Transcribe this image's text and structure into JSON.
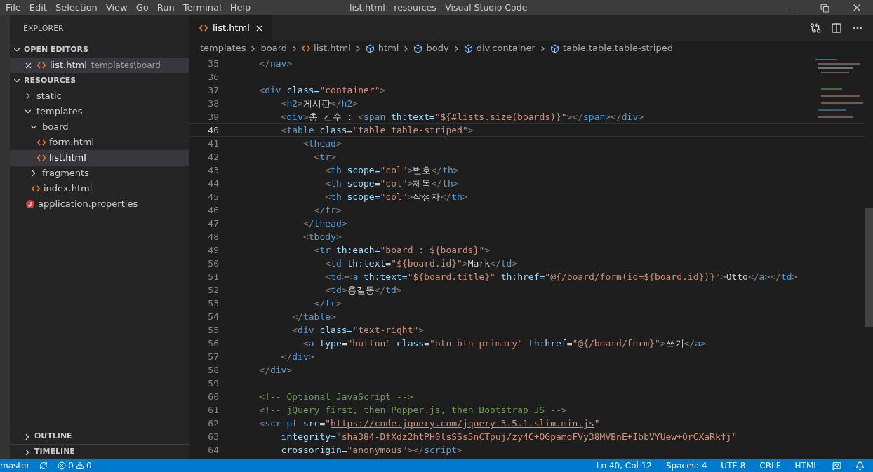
{
  "window": {
    "title": "list.html - resources - Visual Studio Code"
  },
  "menu": [
    "File",
    "Edit",
    "Selection",
    "View",
    "Go",
    "Run",
    "Terminal",
    "Help"
  ],
  "sidebar": {
    "title": "EXPLORER",
    "open_editors": {
      "label": "OPEN EDITORS",
      "expanded": true,
      "items": [
        {
          "name": "list.html",
          "path": "templates\\board",
          "selected": true
        }
      ]
    },
    "folder": {
      "label": "RESOURCES",
      "expanded": true,
      "children": [
        {
          "kind": "folder",
          "name": "static",
          "expanded": false,
          "selected": false
        },
        {
          "kind": "folder",
          "name": "templates",
          "expanded": true,
          "selected": false,
          "children": [
            {
              "kind": "folder",
              "name": "board",
              "expanded": true,
              "selected": false,
              "children": [
                {
                  "kind": "html",
                  "name": "form.html",
                  "selected": false
                },
                {
                  "kind": "html",
                  "name": "list.html",
                  "selected": true
                }
              ]
            },
            {
              "kind": "folder",
              "name": "fragments",
              "expanded": false,
              "selected": false
            },
            {
              "kind": "html",
              "name": "index.html",
              "selected": false
            }
          ]
        },
        {
          "kind": "properties",
          "name": "application.properties",
          "selected": false
        }
      ]
    },
    "sections": [
      {
        "label": "OUTLINE",
        "expanded": false
      },
      {
        "label": "TIMELINE",
        "expanded": false
      }
    ]
  },
  "tabs": [
    {
      "label": "list.html",
      "selected": true
    }
  ],
  "breadcrumb": [
    {
      "kind": "folder",
      "label": "templates"
    },
    {
      "kind": "folder",
      "label": "board"
    },
    {
      "kind": "html",
      "label": "list.html"
    },
    {
      "kind": "element",
      "label": "html"
    },
    {
      "kind": "element",
      "label": "body"
    },
    {
      "kind": "element",
      "label": "div.container"
    },
    {
      "kind": "element",
      "label": "table.table.table-striped"
    }
  ],
  "code": [
    {
      "number": "35",
      "current": false,
      "tokens": [
        {
          "kind": "punct",
          "text": "    </"
        },
        {
          "kind": "tag",
          "text": "nav"
        },
        {
          "kind": "punct",
          "text": ">"
        }
      ]
    },
    {
      "number": "36",
      "current": false
    },
    {
      "number": "37",
      "current": false,
      "tokens": [
        {
          "kind": "punct",
          "text": "    <"
        },
        {
          "kind": "tag",
          "text": "div"
        },
        {
          "kind": "attr",
          "text": " class="
        },
        {
          "kind": "string",
          "text": "\"container\""
        },
        {
          "kind": "punct",
          "text": ">"
        }
      ]
    },
    {
      "number": "38",
      "current": false,
      "tokens": [
        {
          "kind": "punct",
          "text": "        <"
        },
        {
          "kind": "tag",
          "text": "h2"
        },
        {
          "kind": "punct",
          "text": ">"
        },
        {
          "kind": "text",
          "text": "게시판"
        },
        {
          "kind": "punct",
          "text": "</"
        },
        {
          "kind": "tag",
          "text": "h2"
        },
        {
          "kind": "punct",
          "text": ">"
        }
      ]
    },
    {
      "number": "39",
      "current": false,
      "tokens": [
        {
          "kind": "punct",
          "text": "        <"
        },
        {
          "kind": "tag",
          "text": "div"
        },
        {
          "kind": "punct",
          "text": ">"
        },
        {
          "kind": "text",
          "text": "총 건수 : "
        },
        {
          "kind": "punct",
          "text": "<"
        },
        {
          "kind": "tag",
          "text": "span"
        },
        {
          "kind": "attr",
          "text": " th:text="
        },
        {
          "kind": "string",
          "text": "\"${#lists.size(boards)}\""
        },
        {
          "kind": "punct",
          "text": "></"
        },
        {
          "kind": "tag",
          "text": "span"
        },
        {
          "kind": "punct",
          "text": "></"
        },
        {
          "kind": "tag",
          "text": "div"
        },
        {
          "kind": "punct",
          "text": ">"
        }
      ]
    },
    {
      "number": "40",
      "current": true,
      "tokens": [
        {
          "kind": "punct",
          "text": "        <"
        },
        {
          "kind": "tag",
          "text": "table"
        },
        {
          "kind": "attr",
          "text": " class="
        },
        {
          "kind": "string",
          "text": "\"table table-striped\""
        },
        {
          "kind": "punct",
          "text": ">"
        }
      ]
    },
    {
      "number": "41",
      "current": false,
      "tokens": [
        {
          "kind": "punct",
          "text": "            <"
        },
        {
          "kind": "tag",
          "text": "thead"
        },
        {
          "kind": "punct",
          "text": ">"
        }
      ]
    },
    {
      "number": "42",
      "current": false,
      "tokens": [
        {
          "kind": "punct",
          "text": "              <"
        },
        {
          "kind": "tag",
          "text": "tr"
        },
        {
          "kind": "punct",
          "text": ">"
        }
      ]
    },
    {
      "number": "43",
      "current": false,
      "tokens": [
        {
          "kind": "punct",
          "text": "                <"
        },
        {
          "kind": "tag",
          "text": "th"
        },
        {
          "kind": "attr",
          "text": " scope="
        },
        {
          "kind": "string",
          "text": "\"col\""
        },
        {
          "kind": "punct",
          "text": ">"
        },
        {
          "kind": "text",
          "text": "번호"
        },
        {
          "kind": "punct",
          "text": "</"
        },
        {
          "kind": "tag",
          "text": "th"
        },
        {
          "kind": "punct",
          "text": ">"
        }
      ]
    },
    {
      "number": "44",
      "current": false,
      "tokens": [
        {
          "kind": "punct",
          "text": "                <"
        },
        {
          "kind": "tag",
          "text": "th"
        },
        {
          "kind": "attr",
          "text": " scope="
        },
        {
          "kind": "string",
          "text": "\"col\""
        },
        {
          "kind": "punct",
          "text": ">"
        },
        {
          "kind": "text",
          "text": "제목"
        },
        {
          "kind": "punct",
          "text": "</"
        },
        {
          "kind": "tag",
          "text": "th"
        },
        {
          "kind": "punct",
          "text": ">"
        }
      ]
    },
    {
      "number": "45",
      "current": false,
      "tokens": [
        {
          "kind": "punct",
          "text": "                <"
        },
        {
          "kind": "tag",
          "text": "th"
        },
        {
          "kind": "attr",
          "text": " scope="
        },
        {
          "kind": "string",
          "text": "\"col\""
        },
        {
          "kind": "punct",
          "text": ">"
        },
        {
          "kind": "text",
          "text": "작성자"
        },
        {
          "kind": "punct",
          "text": "</"
        },
        {
          "kind": "tag",
          "text": "th"
        },
        {
          "kind": "punct",
          "text": ">"
        }
      ]
    },
    {
      "number": "46",
      "current": false,
      "tokens": [
        {
          "kind": "punct",
          "text": "              </"
        },
        {
          "kind": "tag",
          "text": "tr"
        },
        {
          "kind": "punct",
          "text": ">"
        }
      ]
    },
    {
      "number": "47",
      "current": false,
      "tokens": [
        {
          "kind": "punct",
          "text": "            </"
        },
        {
          "kind": "tag",
          "text": "thead"
        },
        {
          "kind": "punct",
          "text": ">"
        }
      ]
    },
    {
      "number": "48",
      "current": false,
      "tokens": [
        {
          "kind": "punct",
          "text": "            <"
        },
        {
          "kind": "tag",
          "text": "tbody"
        },
        {
          "kind": "punct",
          "text": ">"
        }
      ]
    },
    {
      "number": "49",
      "current": false,
      "tokens": [
        {
          "kind": "punct",
          "text": "              <"
        },
        {
          "kind": "tag",
          "text": "tr"
        },
        {
          "kind": "attr",
          "text": " th:each="
        },
        {
          "kind": "string",
          "text": "\"board : ${boards}\""
        },
        {
          "kind": "punct",
          "text": ">"
        }
      ]
    },
    {
      "number": "50",
      "current": false,
      "tokens": [
        {
          "kind": "punct",
          "text": "                <"
        },
        {
          "kind": "tag",
          "text": "td"
        },
        {
          "kind": "attr",
          "text": " th:text="
        },
        {
          "kind": "string",
          "text": "\"${board.id}\""
        },
        {
          "kind": "punct",
          "text": ">"
        },
        {
          "kind": "text",
          "text": "Mark"
        },
        {
          "kind": "punct",
          "text": "</"
        },
        {
          "kind": "tag",
          "text": "td"
        },
        {
          "kind": "punct",
          "text": ">"
        }
      ]
    },
    {
      "number": "51",
      "current": false,
      "tokens": [
        {
          "kind": "punct",
          "text": "                <"
        },
        {
          "kind": "tag",
          "text": "td"
        },
        {
          "kind": "punct",
          "text": "><"
        },
        {
          "kind": "tag",
          "text": "a"
        },
        {
          "kind": "attr",
          "text": " th:text="
        },
        {
          "kind": "string",
          "text": "\"${board.title}\""
        },
        {
          "kind": "attr",
          "text": " th:href="
        },
        {
          "kind": "string",
          "text": "\"@{/board/form(id=${board.id})}\""
        },
        {
          "kind": "punct",
          "text": ">"
        },
        {
          "kind": "text",
          "text": "Otto"
        },
        {
          "kind": "punct",
          "text": "</"
        },
        {
          "kind": "tag",
          "text": "a"
        },
        {
          "kind": "punct",
          "text": "></"
        },
        {
          "kind": "tag",
          "text": "td"
        },
        {
          "kind": "punct",
          "text": ">"
        }
      ]
    },
    {
      "number": "52",
      "current": false,
      "tokens": [
        {
          "kind": "punct",
          "text": "                <"
        },
        {
          "kind": "tag",
          "text": "td"
        },
        {
          "kind": "punct",
          "text": ">"
        },
        {
          "kind": "text",
          "text": "홍길동"
        },
        {
          "kind": "punct",
          "text": "</"
        },
        {
          "kind": "tag",
          "text": "td"
        },
        {
          "kind": "punct",
          "text": ">"
        }
      ]
    },
    {
      "number": "53",
      "current": false,
      "tokens": [
        {
          "kind": "punct",
          "text": "              </"
        },
        {
          "kind": "tag",
          "text": "tr"
        },
        {
          "kind": "punct",
          "text": ">"
        }
      ]
    },
    {
      "number": "54",
      "current": false,
      "tokens": [
        {
          "kind": "punct",
          "text": "          </"
        },
        {
          "kind": "tag",
          "text": "table"
        },
        {
          "kind": "punct",
          "text": ">"
        }
      ]
    },
    {
      "number": "55",
      "current": false,
      "tokens": [
        {
          "kind": "punct",
          "text": "          <"
        },
        {
          "kind": "tag",
          "text": "div"
        },
        {
          "kind": "attr",
          "text": " class="
        },
        {
          "kind": "string",
          "text": "\"text-right\""
        },
        {
          "kind": "punct",
          "text": ">"
        }
      ]
    },
    {
      "number": "56",
      "current": false,
      "tokens": [
        {
          "kind": "punct",
          "text": "            <"
        },
        {
          "kind": "tag",
          "text": "a"
        },
        {
          "kind": "attr",
          "text": " type="
        },
        {
          "kind": "string",
          "text": "\"button\""
        },
        {
          "kind": "attr",
          "text": " class="
        },
        {
          "kind": "string",
          "text": "\"btn btn-primary\""
        },
        {
          "kind": "attr",
          "text": " th:href="
        },
        {
          "kind": "string",
          "text": "\"@{/board/form}\""
        },
        {
          "kind": "punct",
          "text": ">"
        },
        {
          "kind": "text",
          "text": "쓰기"
        },
        {
          "kind": "punct",
          "text": "</"
        },
        {
          "kind": "tag",
          "text": "a"
        },
        {
          "kind": "punct",
          "text": ">"
        }
      ]
    },
    {
      "number": "57",
      "current": false,
      "tokens": [
        {
          "kind": "punct",
          "text": "        </"
        },
        {
          "kind": "tag",
          "text": "div"
        },
        {
          "kind": "punct",
          "text": ">"
        }
      ]
    },
    {
      "number": "58",
      "current": false,
      "tokens": [
        {
          "kind": "punct",
          "text": "    </"
        },
        {
          "kind": "tag",
          "text": "div"
        },
        {
          "kind": "punct",
          "text": ">"
        }
      ]
    },
    {
      "number": "59",
      "current": false
    },
    {
      "number": "60",
      "current": false,
      "tokens": [
        {
          "kind": "comment",
          "text": "    <!-- Optional JavaScript -->"
        }
      ]
    },
    {
      "number": "61",
      "current": false,
      "tokens": [
        {
          "kind": "comment",
          "text": "    <!-- jQuery first, then Popper.js, then Bootstrap JS -->"
        }
      ]
    },
    {
      "number": "62",
      "current": false,
      "tokens": [
        {
          "kind": "punct",
          "text": "    <"
        },
        {
          "kind": "tag",
          "text": "script"
        },
        {
          "kind": "attr",
          "text": " src="
        },
        {
          "kind": "string",
          "text": "\""
        },
        {
          "kind": "url",
          "text": "https://code.jquery.com/jquery-3.5.1.slim.min.js"
        },
        {
          "kind": "string",
          "text": "\""
        }
      ]
    },
    {
      "number": "63",
      "current": false,
      "tokens": [
        {
          "kind": "attr",
          "text": "        integrity="
        },
        {
          "kind": "string",
          "text": "\"sha384-DfXdz2htPH0lsSSs5nCTpuj/zy4C+OGpamoFVy38MVBnE+IbbVYUew+OrCXaRkfj\""
        }
      ]
    },
    {
      "number": "64",
      "current": false,
      "tokens": [
        {
          "kind": "attr",
          "text": "        crossorigin="
        },
        {
          "kind": "string",
          "text": "\"anonymous\""
        },
        {
          "kind": "punct",
          "text": "></"
        },
        {
          "kind": "tag",
          "text": "script"
        },
        {
          "kind": "punct",
          "text": ">"
        }
      ]
    }
  ],
  "status_bar": {
    "branch": "master",
    "errors": "0",
    "warnings": "0",
    "position": "Ln 40, Col 12",
    "indent": "Spaces: 4",
    "encoding": "UTF-8",
    "eol": "CRLF",
    "language": "HTML"
  }
}
